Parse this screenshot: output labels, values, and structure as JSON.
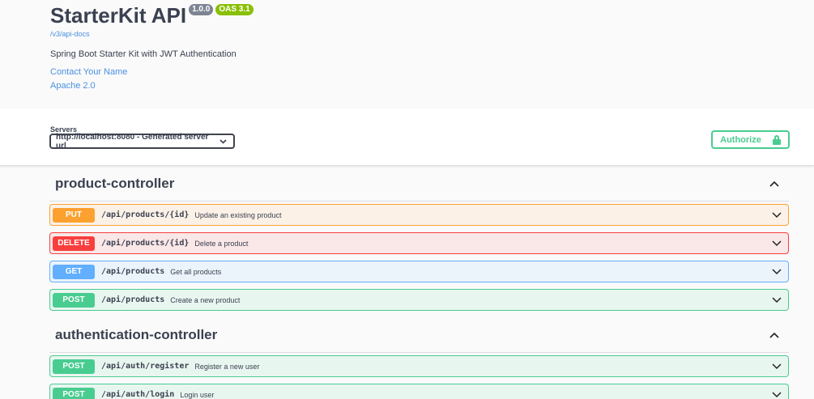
{
  "info": {
    "title": "StarterKit API",
    "version": "1.0.0",
    "oas": "OAS 3.1",
    "docs_url": "/v3/api-docs",
    "description": "Spring Boot Starter Kit with JWT Authentication",
    "contact": "Contact Your Name",
    "license": "Apache 2.0"
  },
  "servers": {
    "label": "Servers",
    "selected": "http://localhost:8080 - Generated server url"
  },
  "authorize": {
    "label": "Authorize"
  },
  "tags": [
    {
      "name": "product-controller",
      "operations": [
        {
          "method": "PUT",
          "path": "/api/products/{id}",
          "summary": "Update an existing product"
        },
        {
          "method": "DELETE",
          "path": "/api/products/{id}",
          "summary": "Delete a product"
        },
        {
          "method": "GET",
          "path": "/api/products",
          "summary": "Get all products"
        },
        {
          "method": "POST",
          "path": "/api/products",
          "summary": "Create a new product"
        }
      ]
    },
    {
      "name": "authentication-controller",
      "operations": [
        {
          "method": "POST",
          "path": "/api/auth/register",
          "summary": "Register a new user"
        },
        {
          "method": "POST",
          "path": "/api/auth/login",
          "summary": "Login user"
        }
      ]
    }
  ],
  "colors": {
    "put": "#fca130",
    "delete": "#f93e3e",
    "get": "#61affe",
    "post": "#49cc90",
    "link": "#4990e2"
  },
  "icons": {
    "tag_toggle": "chevron-up-icon",
    "op_toggle": "chevron-down-icon",
    "authorize": "lock-icon"
  }
}
